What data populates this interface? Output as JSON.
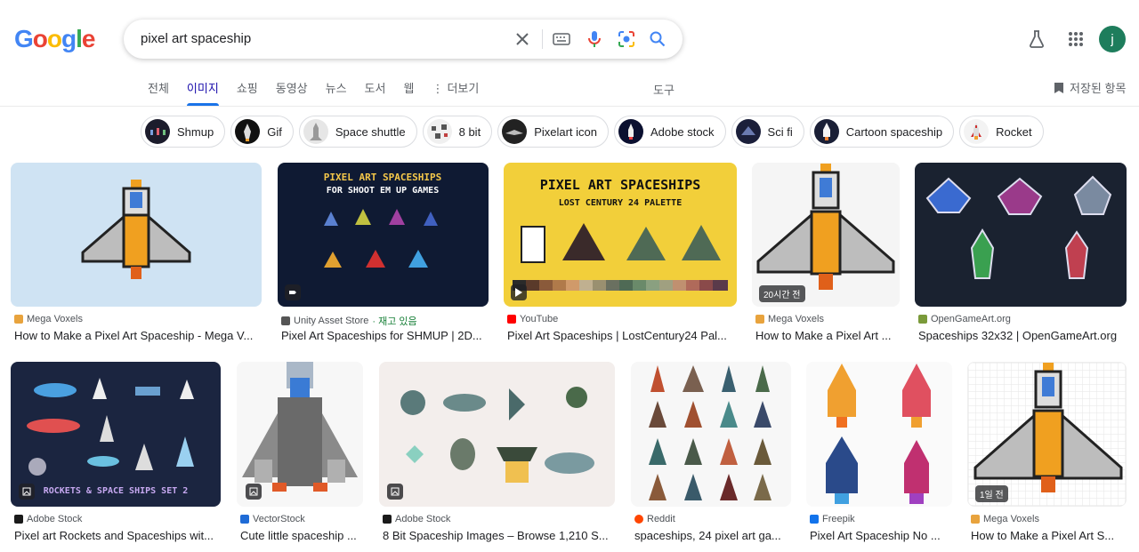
{
  "header": {
    "logo_letters": [
      "G",
      "o",
      "o",
      "g",
      "l",
      "e"
    ],
    "logo_colors": [
      "#4285F4",
      "#EA4335",
      "#FBBC05",
      "#4285F4",
      "#34A853",
      "#EA4335"
    ],
    "query": "pixel art spaceship",
    "avatar_letter": "j"
  },
  "tabs": [
    {
      "label": "전체",
      "active": false
    },
    {
      "label": "이미지",
      "active": true
    },
    {
      "label": "쇼핑",
      "active": false
    },
    {
      "label": "동영상",
      "active": false
    },
    {
      "label": "뉴스",
      "active": false
    },
    {
      "label": "도서",
      "active": false
    },
    {
      "label": "웹",
      "active": false
    }
  ],
  "more_label": "더보기",
  "tools_label": "도구",
  "saved_label": "저장된 항목",
  "chips": [
    {
      "label": "Shmup",
      "thumb_color": "#1c1c2c"
    },
    {
      "label": "Gif",
      "thumb_color": "#111"
    },
    {
      "label": "Space shuttle",
      "thumb_color": "#ddd"
    },
    {
      "label": "8 bit",
      "thumb_color": "#eee"
    },
    {
      "label": "Pixelart icon",
      "thumb_color": "#222"
    },
    {
      "label": "Adobe stock",
      "thumb_color": "#0b1030"
    },
    {
      "label": "Sci fi",
      "thumb_color": "#1b1f3a"
    },
    {
      "label": "Cartoon spaceship",
      "thumb_color": "#1a1f36"
    },
    {
      "label": "Rocket",
      "thumb_color": "#f3f3f3"
    }
  ],
  "results": [
    {
      "source": "Mega Voxels",
      "fav": "#e8a33d",
      "title": "How to Make a Pixel Art Spaceship - Mega V...",
      "bg": "#cfe3f3",
      "extra": "",
      "badge": ""
    },
    {
      "source": "Unity Asset Store",
      "fav": "#555",
      "title": "Pixel Art Spaceships for SHMUP | 2D...",
      "bg": "#0f1a33",
      "extra": " · 재고 있음",
      "badge": "",
      "banner1": "PIXEL ART SPACESHIPS",
      "banner2": "FOR SHOOT EM UP GAMES"
    },
    {
      "source": "YouTube",
      "fav": "#ff0000",
      "title": "Pixel Art Spaceships | LostCentury24 Pal...",
      "bg": "#f2cf3a",
      "extra": "",
      "badge": "",
      "banner1": "PIXEL ART SPACESHIPS",
      "banner2": "LOST CENTURY 24 PALETTE"
    },
    {
      "source": "Mega Voxels",
      "fav": "#e8a33d",
      "title": "How to Make a Pixel Art ...",
      "bg": "#f5f5f5",
      "extra": "",
      "badge": "20시간 전"
    },
    {
      "source": "OpenGameArt.org",
      "fav": "#7a9a3a",
      "title": "Spaceships 32x32 | OpenGameArt.org",
      "bg": "#1a2230",
      "extra": "",
      "badge": ""
    },
    {
      "source": "Adobe Stock",
      "fav": "#1a1a1a",
      "title": "Pixel art Rockets and Spaceships wit...",
      "bg": "#1b2540",
      "extra": "",
      "badge": "",
      "banner1": "ROCKETS & SPACE SHIPS  SET 2"
    },
    {
      "source": "VectorStock",
      "fav": "#1f6bd6",
      "title": "Cute little spaceship ...",
      "bg": "#f7f7f7",
      "extra": "",
      "badge": ""
    },
    {
      "source": "Adobe Stock",
      "fav": "#1a1a1a",
      "title": "8 Bit Spaceship Images – Browse 1,210 S...",
      "bg": "#f3eeec",
      "extra": "",
      "badge": ""
    },
    {
      "source": "Reddit",
      "fav": "#ff4500",
      "title": "spaceships, 24 pixel art ga...",
      "bg": "#f7f7f7",
      "extra": "",
      "badge": ""
    },
    {
      "source": "Freepik",
      "fav": "#1273eb",
      "title": "Pixel Art Spaceship No ...",
      "bg": "#fafafa",
      "extra": "",
      "badge": ""
    },
    {
      "source": "Mega Voxels",
      "fav": "#e8a33d",
      "title": "How to Make a Pixel Art S...",
      "bg": "#ffffff",
      "extra": "",
      "badge": "1일 전"
    }
  ]
}
